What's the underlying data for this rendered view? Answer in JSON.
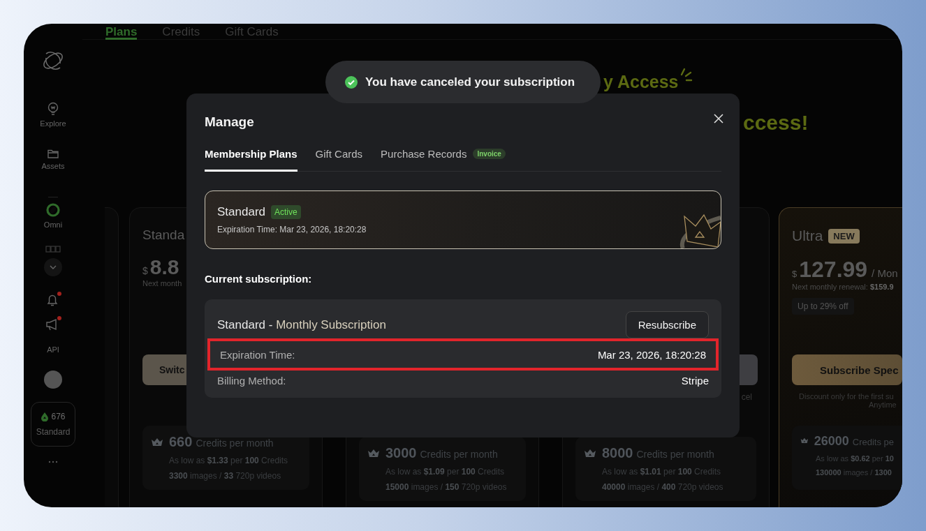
{
  "sidebar": {
    "items": [
      {
        "kind": "logo"
      },
      {
        "kind": "nav",
        "label": "Explore"
      },
      {
        "kind": "nav",
        "label": "Assets"
      },
      {
        "kind": "divider"
      },
      {
        "kind": "nav",
        "label": "Omni"
      },
      {
        "kind": "icon"
      },
      {
        "kind": "icon"
      },
      {
        "kind": "icon",
        "badge": true
      },
      {
        "kind": "icon",
        "badge": true
      },
      {
        "kind": "text",
        "label": "API"
      },
      {
        "kind": "avatar"
      },
      {
        "kind": "credits",
        "amount": "676",
        "plan": "Standard"
      },
      {
        "kind": "more"
      }
    ]
  },
  "page_tabs": [
    {
      "label": "Plans",
      "selected": true
    },
    {
      "label": "Credits",
      "selected": false
    },
    {
      "label": "Gift Cards",
      "selected": false
    }
  ],
  "headline": {
    "line_1": "y Access",
    "line_2": "ccess!"
  },
  "plans": [
    {
      "kind": "edge"
    },
    {
      "kind": "cut-right",
      "title": "Standa",
      "currency": "$",
      "price": "8.8",
      "renewal": "Next month",
      "button": "Switc",
      "credits": {
        "amount": "660",
        "unit": "Credits per month",
        "rate": "As low as **$1.33** per **100** Credits",
        "output": "**3300** images / **33** 720p videos"
      }
    },
    {
      "kind": "hidden",
      "credits": {
        "amount": "3000",
        "unit": "Credits per month",
        "rate": "As low as **$1.09** per **100** Credits",
        "output": "**15000** images / **150** 720p videos"
      }
    },
    {
      "kind": "cut-left",
      "note": "cel",
      "credits": {
        "amount": "8000",
        "unit": "Credits per month",
        "rate": "As low as **$1.01** per **100** Credits",
        "output": "**40000** images / **400** 720p videos"
      }
    },
    {
      "kind": "featured",
      "title": "Ultra",
      "badge": "NEW",
      "currency": "$",
      "price": "127.99",
      "period": "/ Mon",
      "renewal": "Next monthly renewal: **$159.9**",
      "discount": "Up to 29% off",
      "button": "Subscribe Spec",
      "note_lines": [
        "Discount only for the first su",
        "Anytime"
      ],
      "credits": {
        "amount": "26000",
        "unit": "Credits pe",
        "rate": "As low as **$0.62** per **10**",
        "output": "**130000** images / **1300**"
      }
    }
  ],
  "toast": {
    "message": "You have canceled your subscription"
  },
  "modal": {
    "title": "Manage",
    "tabs": [
      {
        "label": "Membership Plans",
        "selected": true
      },
      {
        "label": "Gift Cards",
        "selected": false
      },
      {
        "label": "Purchase Records",
        "selected": false,
        "badge": "Invoice"
      }
    ],
    "plan_card": {
      "name": "Standard",
      "status": "Active",
      "expiration": "Expiration Time: Mar 23, 2026, 18:20:28"
    },
    "section_title": "Current subscription:",
    "subscription": {
      "plan": "Standard -",
      "period": "Monthly Subscription",
      "action": "Resubscribe",
      "rows": [
        {
          "label": "Expiration Time:",
          "value": "Mar 23, 2026, 18:20:28",
          "highlighted": true
        },
        {
          "label": "Billing Method:",
          "value": "Stripe",
          "highlighted": false
        }
      ]
    }
  }
}
